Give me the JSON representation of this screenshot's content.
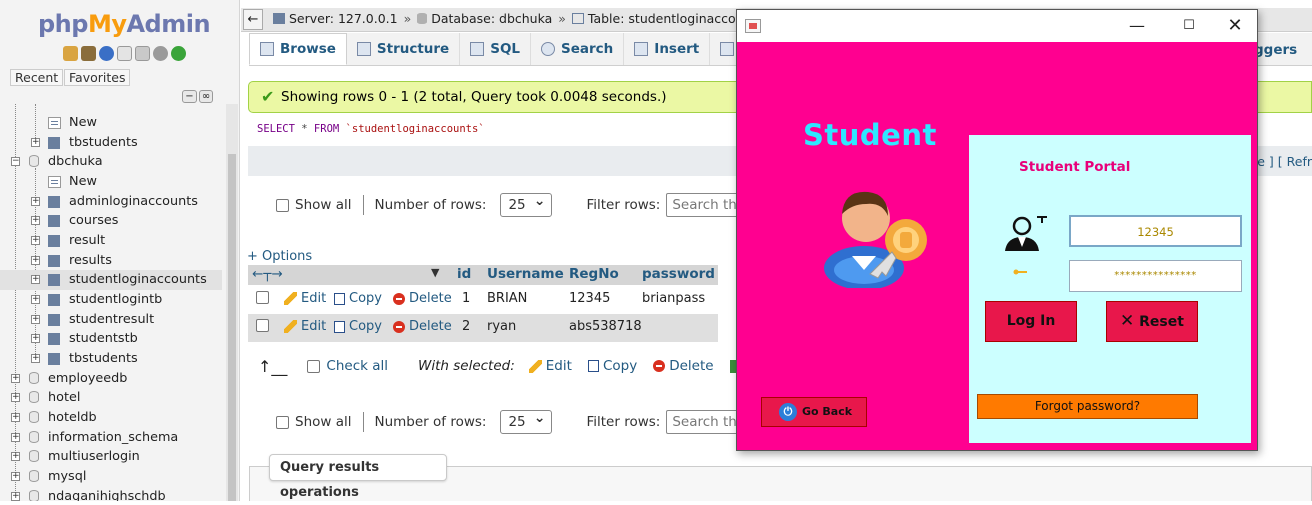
{
  "nav": {
    "logo": {
      "php": "php",
      "my": "My",
      "admin": "Admin"
    },
    "recent_label": "Recent",
    "favorites_label": "Favorites",
    "tree": [
      {
        "label": "New"
      },
      {
        "label": "tbstudents"
      },
      {
        "label": "dbchuka"
      },
      {
        "label": "New"
      },
      {
        "label": "adminloginaccounts"
      },
      {
        "label": "courses"
      },
      {
        "label": "result"
      },
      {
        "label": "results"
      },
      {
        "label": "studentloginaccounts"
      },
      {
        "label": "studentlogintb"
      },
      {
        "label": "studentresult"
      },
      {
        "label": "studentstb"
      },
      {
        "label": "tbstudents"
      },
      {
        "label": "employeedb"
      },
      {
        "label": "hotel"
      },
      {
        "label": "hoteldb"
      },
      {
        "label": "information_schema"
      },
      {
        "label": "multiuserlogin"
      },
      {
        "label": "mysql"
      },
      {
        "label": "ndaganihighschdb"
      }
    ]
  },
  "breadcrumb": {
    "server": "Server: 127.0.0.1",
    "database": "Database: dbchuka",
    "table": "Table: studentloginaccounts",
    "sep": "»"
  },
  "tabs": [
    "Browse",
    "Structure",
    "SQL",
    "Search",
    "Insert",
    "E"
  ],
  "tab_triggers": "ggers",
  "success_message": "Showing rows 0 - 1 (2 total, Query took 0.0048 seconds.)",
  "sql": {
    "select": "SELECT",
    "star": "*",
    "from": "FROM",
    "table": "`studentloginaccounts`"
  },
  "sql_links": "le ] [ Refr",
  "controls": {
    "show_all": "Show all",
    "number_of_rows": "Number of rows:",
    "rows_value": "25",
    "filter_rows": "Filter rows:",
    "filter_placeholder": "Search this table"
  },
  "options_link": "+ Options",
  "table": {
    "headers": [
      "id",
      "Username",
      "RegNo",
      "password"
    ],
    "rows": [
      {
        "id": "1",
        "username": "BRIAN",
        "regno": "12345",
        "password": "brianpass"
      },
      {
        "id": "2",
        "username": "ryan",
        "regno": "abs538718",
        "password": ""
      }
    ],
    "actions": {
      "edit": "Edit",
      "copy": "Copy",
      "delete": "Delete"
    }
  },
  "with_selected": {
    "check_all": "Check all",
    "label": "With selected:",
    "edit": "Edit",
    "copy": "Copy",
    "delete": "Delete"
  },
  "query_results_operations": "Query results operations",
  "java_window": {
    "title_heading": "Student",
    "portal_label": "Student Portal",
    "regno_value": "12345",
    "password_mask": "***************",
    "login_button": "Log In",
    "reset_button": "Reset",
    "reset_icon": "✕",
    "forgot_button": "Forgot password?",
    "goback_button": "Go Back",
    "colors": {
      "background": "#ff0090",
      "panel": "#ccffff",
      "heading": "#2ee8ff",
      "button": "#e8174b",
      "forgot": "#ff7a00"
    }
  }
}
